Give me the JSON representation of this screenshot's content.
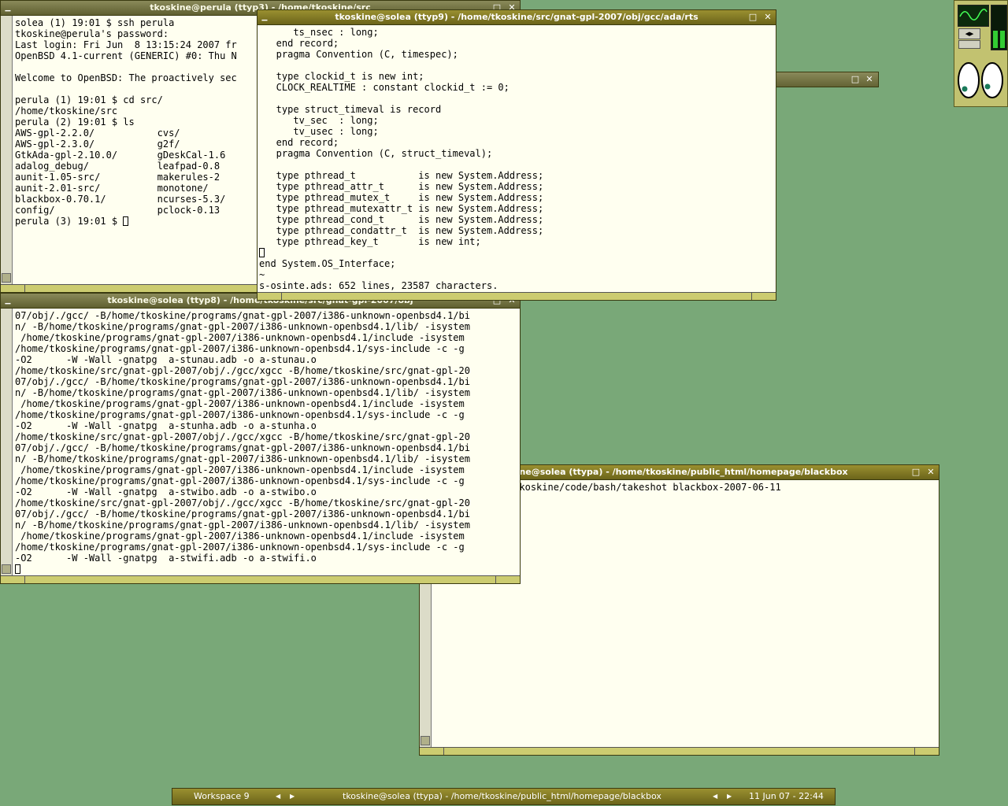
{
  "windows": {
    "perula": {
      "title": "tkoskine@perula (ttyp3) - /home/tkoskine/src",
      "lines": [
        "solea (1) 19:01 $ ssh perula",
        "tkoskine@perula's password:",
        "Last login: Fri Jun  8 13:15:24 2007 fr",
        "OpenBSD 4.1-current (GENERIC) #0: Thu N",
        "",
        "Welcome to OpenBSD: The proactively sec",
        "",
        "perula (1) 19:01 $ cd src/",
        "/home/tkoskine/src",
        "perula (2) 19:01 $ ls",
        "AWS-gpl-2.2.0/           cvs/",
        "AWS-gpl-2.3.0/           g2f/",
        "GtkAda-gpl-2.10.0/       gDeskCal-1.6",
        "adalog_debug/            leafpad-0.8",
        "aunit-1.05-src/          makerules-2",
        "aunit-2.01-src/          monotone/",
        "blackbox-0.70.1/         ncurses-5.3/",
        "config/                  pclock-0.13"
      ],
      "prompt": "perula (3) 19:01 $ "
    },
    "rts": {
      "title": "tkoskine@solea (ttyp9) - /home/tkoskine/src/gnat-gpl-2007/obj/gcc/ada/rts",
      "lines": [
        "      ts_nsec : long;",
        "   end record;",
        "   pragma Convention (C, timespec);",
        "",
        "   type clockid_t is new int;",
        "   CLOCK_REALTIME : constant clockid_t := 0;",
        "",
        "   type struct_timeval is record",
        "      tv_sec  : long;",
        "      tv_usec : long;",
        "   end record;",
        "   pragma Convention (C, struct_timeval);",
        "",
        "   type pthread_t           is new System.Address;",
        "   type pthread_attr_t      is new System.Address;",
        "   type pthread_mutex_t     is new System.Address;",
        "   type pthread_mutexattr_t is new System.Address;",
        "   type pthread_cond_t      is new System.Address;",
        "   type pthread_condattr_t  is new System.Address;",
        "   type pthread_key_t       is new int;"
      ],
      "after_cursor": [
        "end System.OS_Interface;",
        "~",
        "s-osinte.ads: 652 lines, 23587 characters."
      ]
    },
    "obj": {
      "title": "tkoskine@solea (ttyp8) - /home/tkoskine/src/gnat-gpl-2007/obj",
      "lines": [
        "07/obj/./gcc/ -B/home/tkoskine/programs/gnat-gpl-2007/i386-unknown-openbsd4.1/bi",
        "n/ -B/home/tkoskine/programs/gnat-gpl-2007/i386-unknown-openbsd4.1/lib/ -isystem",
        " /home/tkoskine/programs/gnat-gpl-2007/i386-unknown-openbsd4.1/include -isystem",
        "/home/tkoskine/programs/gnat-gpl-2007/i386-unknown-openbsd4.1/sys-include -c -g",
        "-O2      -W -Wall -gnatpg  a-stunau.adb -o a-stunau.o",
        "/home/tkoskine/src/gnat-gpl-2007/obj/./gcc/xgcc -B/home/tkoskine/src/gnat-gpl-20",
        "07/obj/./gcc/ -B/home/tkoskine/programs/gnat-gpl-2007/i386-unknown-openbsd4.1/bi",
        "n/ -B/home/tkoskine/programs/gnat-gpl-2007/i386-unknown-openbsd4.1/lib/ -isystem",
        " /home/tkoskine/programs/gnat-gpl-2007/i386-unknown-openbsd4.1/include -isystem",
        "/home/tkoskine/programs/gnat-gpl-2007/i386-unknown-openbsd4.1/sys-include -c -g",
        "-O2      -W -Wall -gnatpg  a-stunha.adb -o a-stunha.o",
        "/home/tkoskine/src/gnat-gpl-2007/obj/./gcc/xgcc -B/home/tkoskine/src/gnat-gpl-20",
        "07/obj/./gcc/ -B/home/tkoskine/programs/gnat-gpl-2007/i386-unknown-openbsd4.1/bi",
        "n/ -B/home/tkoskine/programs/gnat-gpl-2007/i386-unknown-openbsd4.1/lib/ -isystem",
        " /home/tkoskine/programs/gnat-gpl-2007/i386-unknown-openbsd4.1/include -isystem",
        "/home/tkoskine/programs/gnat-gpl-2007/i386-unknown-openbsd4.1/sys-include -c -g",
        "-O2      -W -Wall -gnatpg  a-stwibo.adb -o a-stwibo.o",
        "/home/tkoskine/src/gnat-gpl-2007/obj/./gcc/xgcc -B/home/tkoskine/src/gnat-gpl-20",
        "07/obj/./gcc/ -B/home/tkoskine/programs/gnat-gpl-2007/i386-unknown-openbsd4.1/bi",
        "n/ -B/home/tkoskine/programs/gnat-gpl-2007/i386-unknown-openbsd4.1/lib/ -isystem",
        " /home/tkoskine/programs/gnat-gpl-2007/i386-unknown-openbsd4.1/include -isystem",
        "/home/tkoskine/programs/gnat-gpl-2007/i386-unknown-openbsd4.1/sys-include -c -g",
        "-O2      -W -Wall -gnatpg  a-stwifi.adb -o a-stwifi.o"
      ]
    },
    "blackbox": {
      "title": "kine@solea (ttypa) - /home/tkoskine/public_html/homepage/blackbox",
      "lines": [
        "44 $ sh /home/tkoskine/code/bash/takeshot blackbox-2007-06-11"
      ]
    }
  },
  "toolbar": {
    "workspace": "Workspace 9",
    "window_title": "tkoskine@solea (ttypa) - /home/tkoskine/public_html/homepage/blackbox",
    "clock": "11 Jun 07 - 22:44"
  },
  "icons": {
    "minimize": "▁",
    "maximize": "□",
    "close": "✕",
    "prev": "◀",
    "next": "▶"
  },
  "colors": {
    "desktop": "#79a878",
    "titlebar": "#8a8226",
    "terminal_bg": "#fffff0"
  }
}
